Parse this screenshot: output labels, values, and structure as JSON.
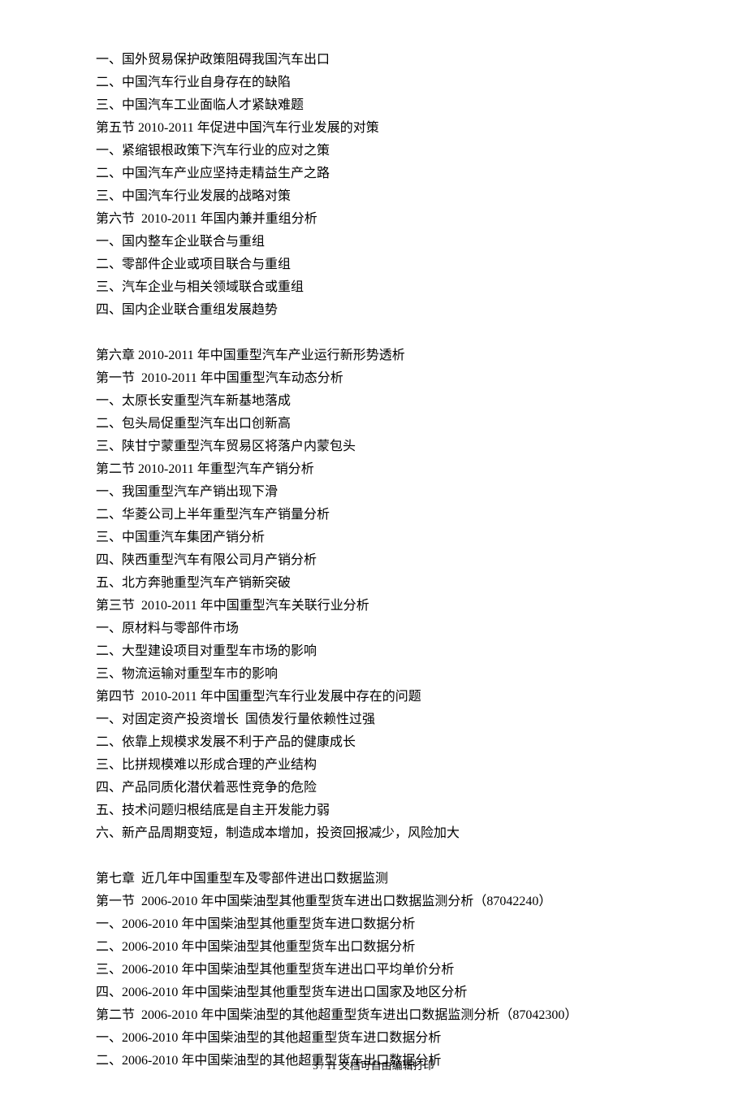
{
  "lines": [
    "一、国外贸易保护政策阻碍我国汽车出口",
    "二、中国汽车行业自身存在的缺陷",
    "三、中国汽车工业面临人才紧缺难题",
    "第五节 2010-2011 年促进中国汽车行业发展的对策",
    "一、紧缩银根政策下汽车行业的应对之策",
    "二、中国汽车产业应坚持走精益生产之路",
    "三、中国汽车行业发展的战略对策",
    "第六节  2010-2011 年国内兼并重组分析",
    "一、国内整车企业联合与重组",
    "二、零部件企业或项目联合与重组",
    "三、汽车企业与相关领域联合或重组",
    "四、国内企业联合重组发展趋势",
    "",
    "第六章 2010-2011 年中国重型汽车产业运行新形势透析",
    "第一节  2010-2011 年中国重型汽车动态分析",
    "一、太原长安重型汽车新基地落成",
    "二、包头局促重型汽车出口创新高",
    "三、陕甘宁蒙重型汽车贸易区将落户内蒙包头",
    "第二节 2010-2011 年重型汽车产销分析",
    "一、我国重型汽车产销出现下滑",
    "二、华菱公司上半年重型汽车产销量分析",
    "三、中国重汽车集团产销分析",
    "四、陕西重型汽车有限公司月产销分析",
    "五、北方奔驰重型汽车产销新突破",
    "第三节  2010-2011 年中国重型汽车关联行业分析",
    "一、原材料与零部件市场",
    "二、大型建设项目对重型车市场的影响",
    "三、物流运输对重型车市的影响",
    "第四节  2010-2011 年中国重型汽车行业发展中存在的问题",
    "一、对固定资产投资增长  国债发行量依赖性过强",
    "二、依靠上规模求发展不利于产品的健康成长",
    "三、比拼规模难以形成合理的产业结构",
    "四、产品同质化潜伏着恶性竞争的危险",
    "五、技术问题归根结底是自主开发能力弱",
    "六、新产品周期变短，制造成本增加，投资回报减少，风险加大",
    "",
    "第七章  近几年中国重型车及零部件进出口数据监测",
    "第一节  2006-2010 年中国柴油型其他重型货车进出口数据监测分析（87042240）",
    "一、2006-2010 年中国柴油型其他重型货车进口数据分析",
    "二、2006-2010 年中国柴油型其他重型货车出口数据分析",
    "三、2006-2010 年中国柴油型其他重型货车进出口平均单价分析",
    "四、2006-2010 年中国柴油型其他重型货车进出口国家及地区分析",
    "第二节  2006-2010 年中国柴油型的其他超重型货车进出口数据监测分析（87042300）",
    "一、2006-2010 年中国柴油型的其他超重型货车进口数据分析",
    "二、2006-2010 年中国柴油型的其他超重型货车出口数据分析"
  ],
  "footer": "3  / 11 文档可自由编辑打印"
}
